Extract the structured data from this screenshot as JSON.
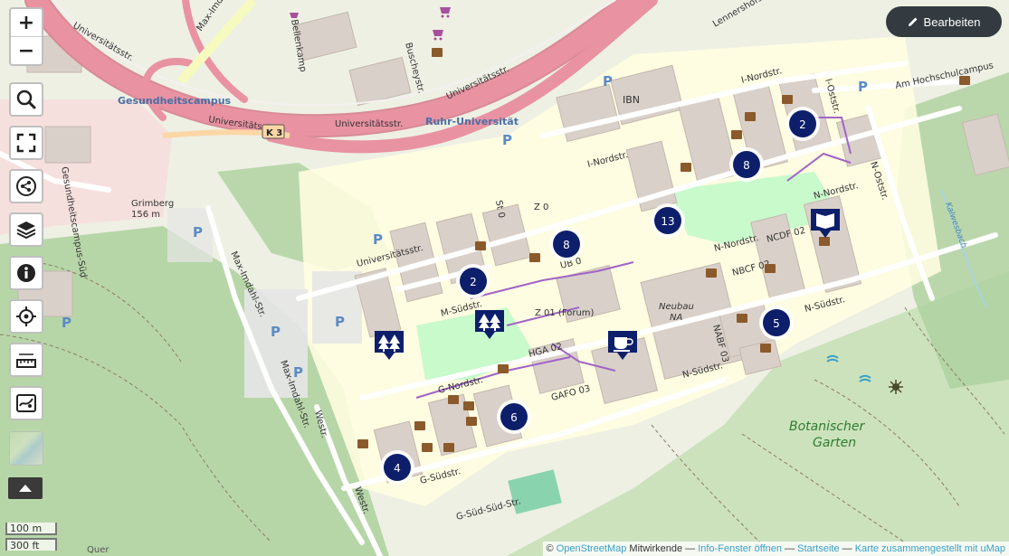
{
  "controls": {
    "zoom_in": "+",
    "zoom_out": "−",
    "tools": [
      "search-icon",
      "fullscreen-icon",
      "share-icon",
      "layers-icon",
      "info-icon",
      "locate-icon",
      "measure-icon",
      "print-map-icon"
    ]
  },
  "edit_button": {
    "label": "Bearbeiten"
  },
  "scale": {
    "metric": "100 m",
    "imperial": "300 ft"
  },
  "attribution": {
    "copy": "©",
    "osm_link": "OpenStreetMap",
    "contributors": "Mitwirkende",
    "sep1": "—",
    "info_link": "Info-Fenster öffnen",
    "sep2": "—",
    "home_link": "Startseite",
    "sep3": "—",
    "umap_link": "Karte zusammengestellt mit uMap"
  },
  "map_labels": {
    "universitaetsstr_a": "Universitätsstr.",
    "universitaetsstr_b": "Universitätsstr.",
    "universitaetsstr_c": "Universitätsstr.",
    "universitaetsstr_d": "Universitätsstr.",
    "universitaetsstr_e": "Universitätsstr.",
    "gesundheitscampus": "Gesundheitscampus",
    "ruhr_universitaet": "Ruhr-Universität",
    "k3": "K 3",
    "max_imbusch": "Max-Imdahl-Str.",
    "max_imbusch_b": "Max-Imdahl-Str.",
    "max_imbusch_c": "Max-Imdahl-Str.",
    "bellenkamp": "Bellenkamp",
    "buscheystr": "Buscheystr.",
    "gesundheitscampus_sued": "Gesundheitscampus-Süd",
    "grimberg": "Grimberg",
    "grimberg_height": "156 m",
    "ibn": "IBN",
    "z0": "Z 0",
    "z01_forum": "Z 01 (Forum)",
    "ub0": "UB 0",
    "i_nordstr": "I-Nordstr.",
    "i_nordstr_b": "I-Nordstr.",
    "n_nordstr": "N-Nordstr.",
    "n_nordstr_b": "N-Nordstr.",
    "n_suedstr": "N-Südstr.",
    "n_suedstr_b": "N-Südstr.",
    "m_suedstr": "M-Südstr.",
    "g_nordstr": "G-Nordstr.",
    "g_suedstr": "G-Südstr.",
    "g_sued_sued_str": "G-Süd-Süd-Str.",
    "hga_02": "HGA 02",
    "gafo_03": "GAFO 03",
    "neubau_na": "Neubau",
    "neubau_na2": "NA",
    "nbcf": "NBCF 02",
    "ncdf": "NCDF 02",
    "nabf": "NABF 03",
    "am_hochschulcampus": "Am Hochschulcampus",
    "lennershofstr": "Lennershofstr.",
    "o_nordstr": "I-Oststr.",
    "n_oststr": "N-Oststr.",
    "botanischer": "Botanischer",
    "garten": "Garten",
    "westr": "Westr.",
    "westr_b": "Westr.",
    "kalwesbach": "Kalwesbach",
    "querenburg": "Quer",
    "stellungsstr": "St 0"
  },
  "clusters": [
    {
      "count": "2"
    },
    {
      "count": "8"
    },
    {
      "count": "13"
    },
    {
      "count": "8"
    },
    {
      "count": "2"
    },
    {
      "count": "5"
    },
    {
      "count": "6"
    },
    {
      "count": "4"
    }
  ],
  "markers": [
    "trees-icon",
    "trees-icon",
    "library-icon",
    "cafe-icon"
  ]
}
